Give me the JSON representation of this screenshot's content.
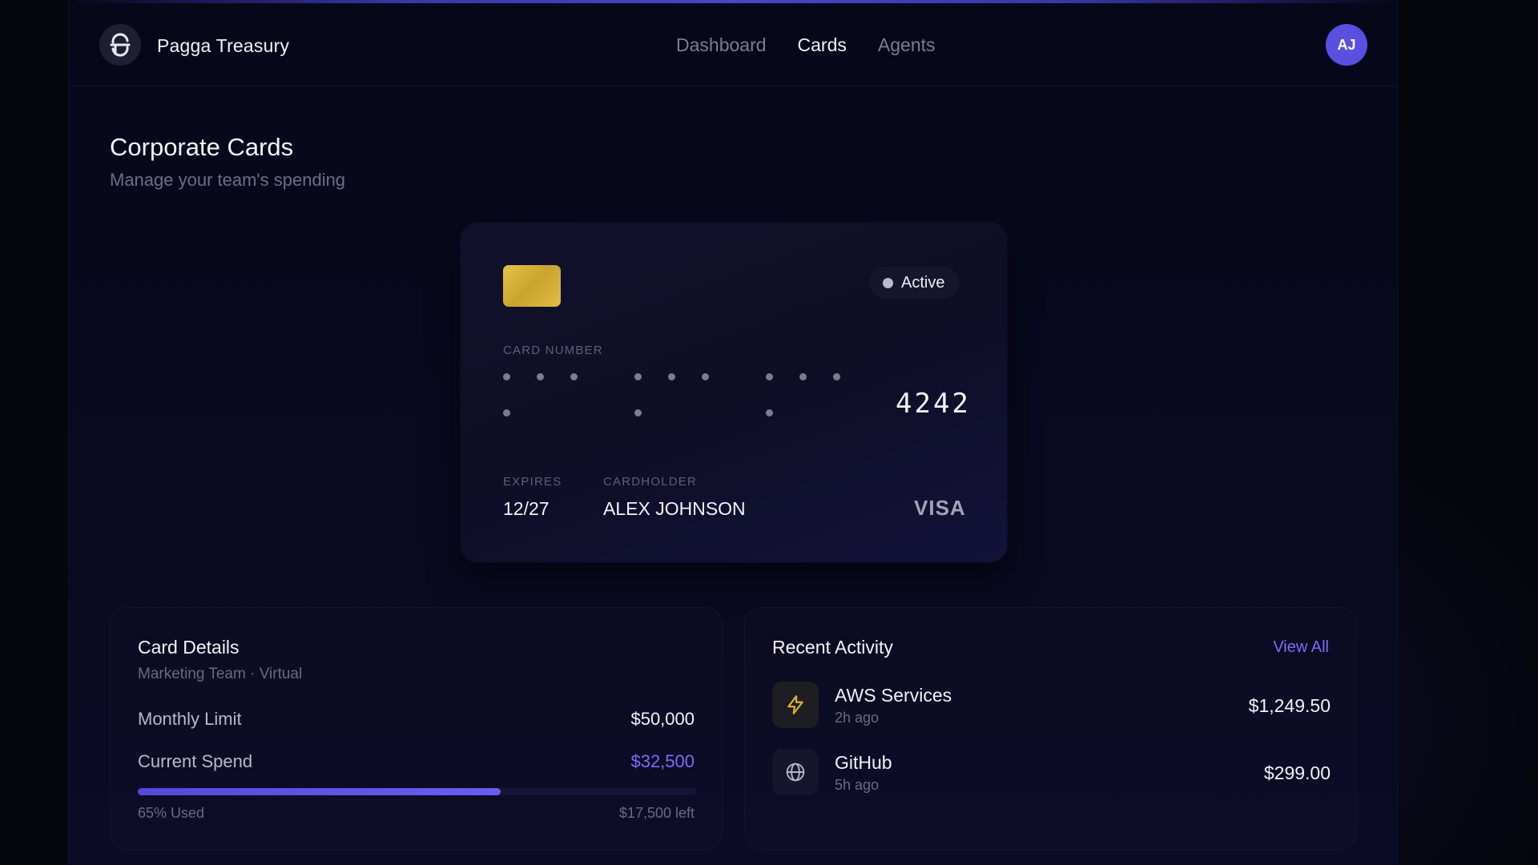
{
  "app": {
    "brand": "Pagga Treasury",
    "avatar_initials": "AJ",
    "accent_color": "#5a4fe0"
  },
  "nav": {
    "items": [
      {
        "label": "Dashboard",
        "active": false
      },
      {
        "label": "Cards",
        "active": true
      },
      {
        "label": "Agents",
        "active": false
      }
    ]
  },
  "page": {
    "title": "Corporate Cards",
    "subtitle": "Manage your team's spending"
  },
  "card": {
    "status": "Active",
    "number_label": "CARD NUMBER",
    "last4": "4242",
    "expires_label": "EXPIRES",
    "expires": "12/27",
    "holder_label": "CARDHOLDER",
    "holder": "ALEX JOHNSON",
    "network": "VISA",
    "chip_color": "#dcb83e"
  },
  "details": {
    "title": "Card Details",
    "subtitle": "Marketing Team · Virtual",
    "monthly_limit_label": "Monthly Limit",
    "monthly_limit": "$50,000",
    "current_spend_label": "Current Spend",
    "current_spend": "$32,500",
    "used_fraction": 0.65,
    "used_text": "65% Used",
    "left_text": "$17,500 left"
  },
  "activity": {
    "title": "Recent Activity",
    "view_all": "View All",
    "items": [
      {
        "name": "AWS Services",
        "time": "2h ago",
        "amount": "$1,249.50",
        "icon": "bolt-icon"
      },
      {
        "name": "GitHub",
        "time": "5h ago",
        "amount": "$299.00",
        "icon": "globe-icon"
      }
    ]
  }
}
